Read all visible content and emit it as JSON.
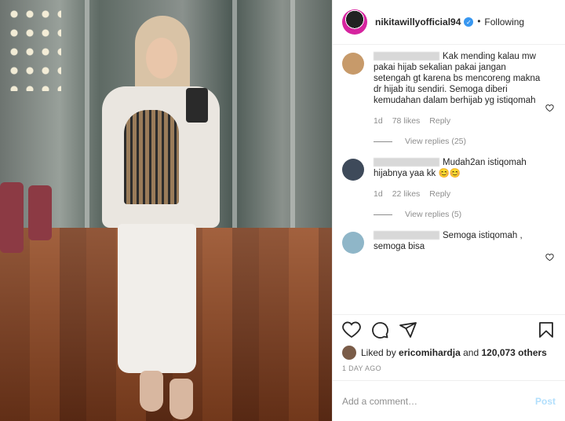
{
  "header": {
    "username": "nikitawillyofficial94",
    "dot": "•",
    "follow_status": "Following"
  },
  "comments": [
    {
      "text": "Kak mending kalau mw pakai hijab sekalian pakai jangan setengah gt karena bs mencoreng makna dr hijab itu sendiri. Semoga diberi kemudahan dalam berhijab yg istiqomah",
      "age": "1d",
      "likes": "78 likes",
      "reply": "Reply",
      "view_replies": "View replies (25)",
      "avatar_color": "#c79a6a"
    },
    {
      "text": "Mudah2an istiqomah hijabnya yaa kk 😊😊",
      "age": "1d",
      "likes": "22 likes",
      "reply": "Reply",
      "view_replies": "View replies (5)",
      "avatar_color": "#3e4a5a"
    },
    {
      "text": "Semoga istiqomah , semoga bisa",
      "avatar_color": "#8fb6c8"
    }
  ],
  "likes": {
    "prefix": "Liked by",
    "user": "ericomihardja",
    "and": "and",
    "others": "120,073 others"
  },
  "age": "1 DAY AGO",
  "add_comment": {
    "placeholder": "Add a comment…",
    "post_label": "Post"
  },
  "colors": {
    "accent": "#3897f0",
    "post_disabled": "#b2dffc"
  }
}
